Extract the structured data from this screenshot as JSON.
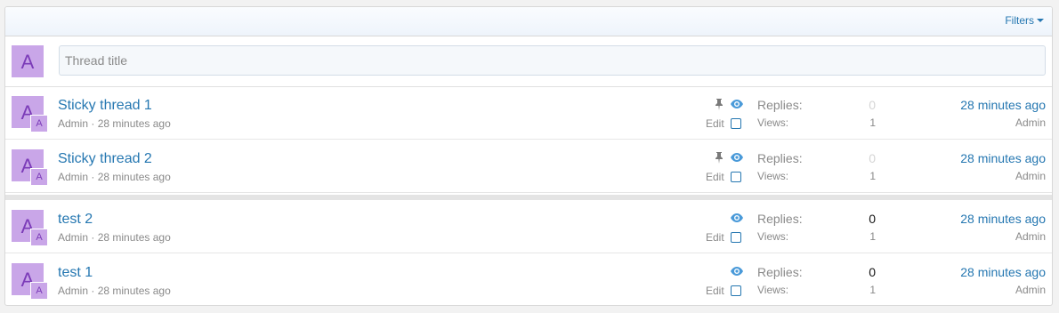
{
  "filters": {
    "label": "Filters"
  },
  "quick_thread": {
    "avatar_letter": "A",
    "title_placeholder": "Thread title"
  },
  "threads": [
    {
      "title": "Sticky thread 1",
      "avatar_letter": "A",
      "author": "Admin",
      "separator": "·",
      "time": "28 minutes ago",
      "sticky": true,
      "edit_label": "Edit",
      "replies_label": "Replies:",
      "replies": "0",
      "views_label": "Views:",
      "views": "1",
      "latest_time": "28 minutes ago",
      "latest_user": "Admin"
    },
    {
      "title": "Sticky thread 2",
      "avatar_letter": "A",
      "author": "Admin",
      "separator": "·",
      "time": "28 minutes ago",
      "sticky": true,
      "edit_label": "Edit",
      "replies_label": "Replies:",
      "replies": "0",
      "views_label": "Views:",
      "views": "1",
      "latest_time": "28 minutes ago",
      "latest_user": "Admin"
    },
    {
      "title": "test 2",
      "avatar_letter": "A",
      "author": "Admin",
      "separator": "·",
      "time": "28 minutes ago",
      "sticky": false,
      "edit_label": "Edit",
      "replies_label": "Replies:",
      "replies": "0",
      "views_label": "Views:",
      "views": "1",
      "latest_time": "28 minutes ago",
      "latest_user": "Admin"
    },
    {
      "title": "test 1",
      "avatar_letter": "A",
      "author": "Admin",
      "separator": "·",
      "time": "28 minutes ago",
      "sticky": false,
      "edit_label": "Edit",
      "replies_label": "Replies:",
      "replies": "0",
      "views_label": "Views:",
      "views": "1",
      "latest_time": "28 minutes ago",
      "latest_user": "Admin"
    }
  ],
  "colors": {
    "link": "#2577b1",
    "muted": "#8a8a8a",
    "avatar_bg": "#c9a6e8",
    "avatar_fg": "#7b3bb8"
  }
}
